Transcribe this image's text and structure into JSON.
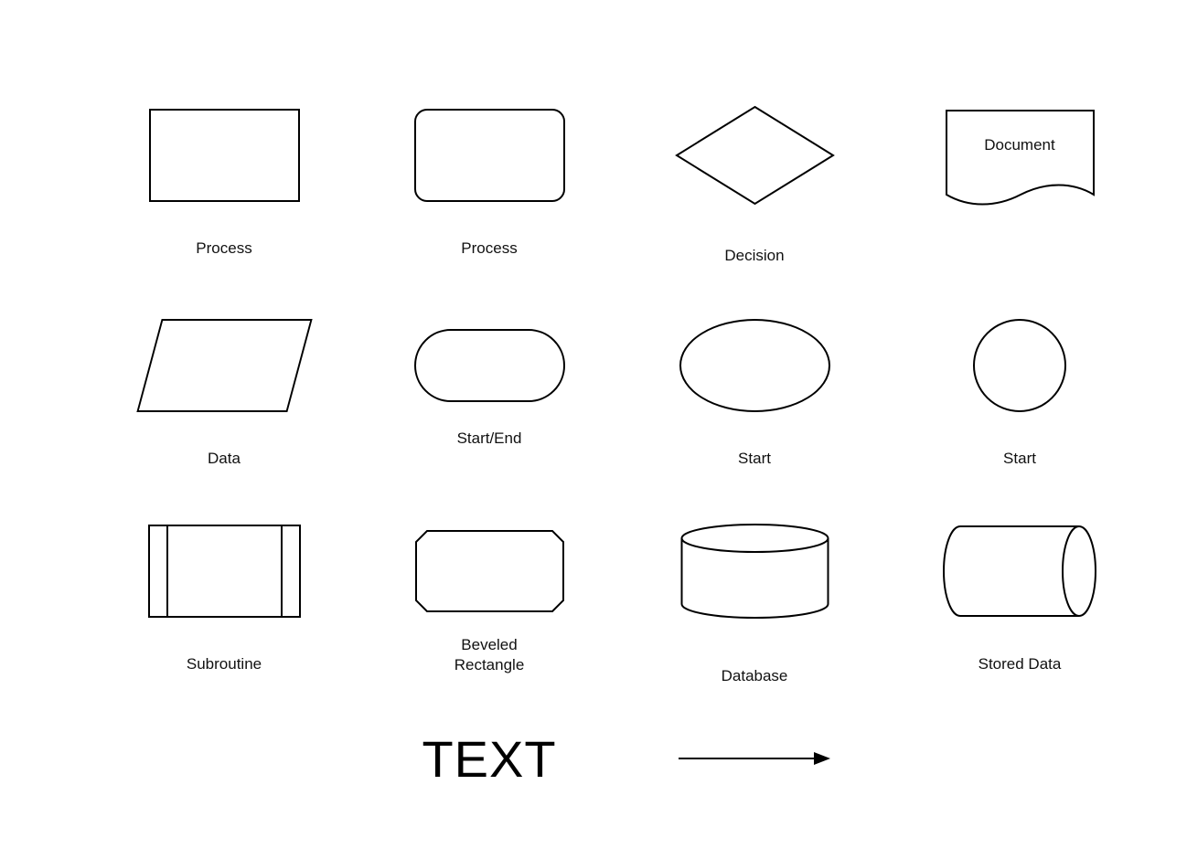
{
  "shapes": {
    "process_rect": "Process",
    "process_rounded": "Process",
    "decision": "Decision",
    "document": "Document",
    "data": "Data",
    "start_end": "Start/End",
    "start_ellipse": "Start",
    "start_circle": "Start",
    "subroutine": "Subroutine",
    "beveled_rectangle": "Beveled\nRectangle",
    "database": "Database",
    "stored_data": "Stored Data"
  },
  "text_block": "TEXT"
}
